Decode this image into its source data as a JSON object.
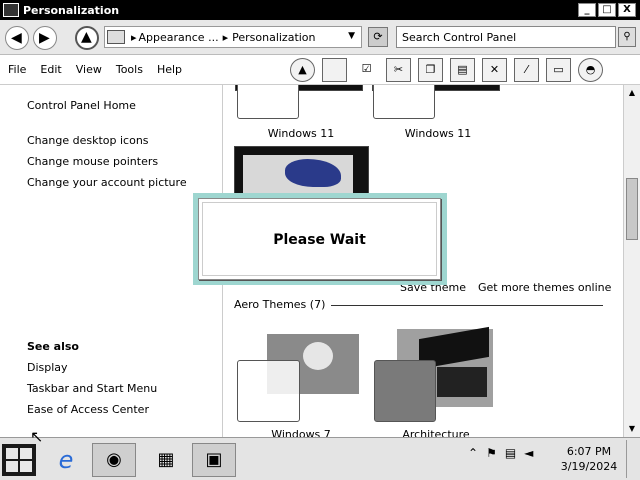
{
  "window": {
    "title": "Personalization",
    "controls": {
      "minimize": "_",
      "maximize": "□",
      "close": "X"
    }
  },
  "address": {
    "crumbs": [
      "Appearance ...",
      "Personalization"
    ],
    "separator": "▸",
    "search_placeholder": "Search Control Panel"
  },
  "menu": [
    "File",
    "Edit",
    "View",
    "Tools",
    "Help"
  ],
  "sidebar": {
    "home": "Control Panel Home",
    "links": [
      "Change desktop icons",
      "Change mouse pointers",
      "Change your account picture"
    ],
    "see_also_title": "See also",
    "see_also": [
      "Display",
      "Taskbar and Start Menu",
      "Ease of Access Center"
    ]
  },
  "themes": {
    "my_themes": [
      "Windows 11",
      "Windows 11"
    ],
    "save_theme": "Save theme",
    "get_more": "Get more themes online",
    "aero_title": "Aero Themes (7)",
    "aero": [
      "Windows 7",
      "Architecture"
    ]
  },
  "dialog": {
    "message": "Please Wait"
  },
  "taskbar": {
    "time": "6:07 PM",
    "date": "3/19/2024"
  },
  "icons": {
    "back": "back-arrow-icon",
    "forward": "forward-arrow-icon",
    "up": "up-arrow-icon",
    "search": "search-icon"
  }
}
